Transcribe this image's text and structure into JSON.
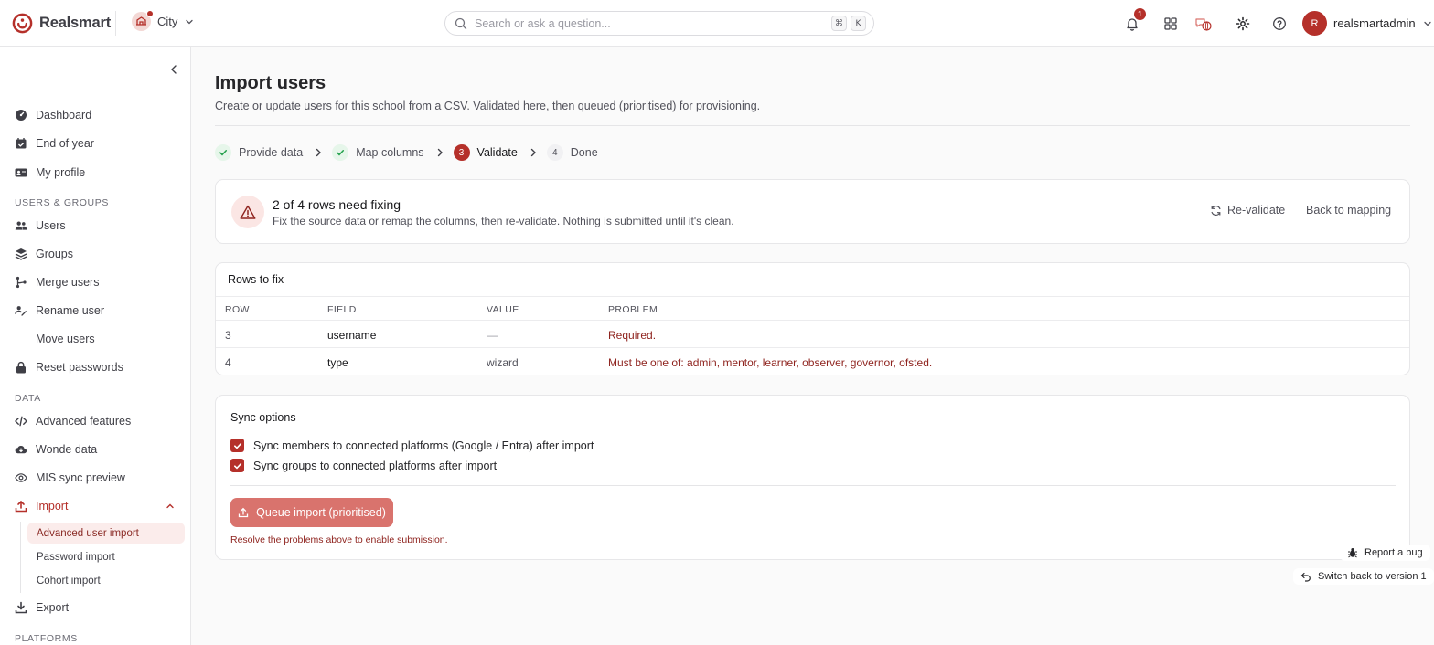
{
  "header": {
    "brand": "Realsmart",
    "org": "City",
    "search_placeholder": "Search or ask a question...",
    "shortcut_keys": [
      "⌘",
      "K"
    ],
    "notification_count": "1",
    "user_initial": "R",
    "user_name": "realsmartadmin"
  },
  "sidebar": {
    "items_top": [
      {
        "label": "Dashboard",
        "icon": "gauge-icon"
      },
      {
        "label": "End of year",
        "icon": "calendar-check-icon"
      },
      {
        "label": "My profile",
        "icon": "id-card-icon"
      }
    ],
    "section_users": "USERS & GROUPS",
    "items_users": [
      {
        "label": "Users",
        "icon": "users-icon"
      },
      {
        "label": "Groups",
        "icon": "layers-icon"
      },
      {
        "label": "Merge users",
        "icon": "merge-icon"
      },
      {
        "label": "Rename user",
        "icon": "signature-icon"
      },
      {
        "label": "Move users",
        "icon": ""
      },
      {
        "label": "Reset passwords",
        "icon": "lock-icon"
      }
    ],
    "section_data": "DATA",
    "items_data": [
      {
        "label": "Advanced features",
        "icon": "code-icon"
      },
      {
        "label": "Wonde data",
        "icon": "cloud-download-icon"
      },
      {
        "label": "MIS sync preview",
        "icon": "eye-icon"
      },
      {
        "label": "Import",
        "icon": "upload-icon"
      }
    ],
    "import_subitems": [
      {
        "label": "Advanced user import",
        "active": true
      },
      {
        "label": "Password import",
        "active": false
      },
      {
        "label": "Cohort import",
        "active": false
      }
    ],
    "export_label": "Export",
    "section_platforms": "PLATFORMS"
  },
  "page": {
    "title": "Import users",
    "description": "Create or update users for this school from a CSV. Validated here, then queued (prioritised) for provisioning."
  },
  "steps": [
    {
      "label": "Provide data",
      "state": "done",
      "num": "1"
    },
    {
      "label": "Map columns",
      "state": "done",
      "num": "2"
    },
    {
      "label": "Validate",
      "state": "current",
      "num": "3"
    },
    {
      "label": "Done",
      "state": "todo",
      "num": "4"
    }
  ],
  "alert": {
    "title": "2 of 4 rows need fixing",
    "description": "Fix the source data or remap the columns, then re-validate. Nothing is submitted until it's clean.",
    "revalidate_label": "Re-validate",
    "back_label": "Back to mapping"
  },
  "rows_to_fix": {
    "title": "Rows to fix",
    "columns": [
      "ROW",
      "FIELD",
      "VALUE",
      "PROBLEM"
    ],
    "rows": [
      {
        "row": "3",
        "field": "username",
        "value": "—",
        "problem": "Required."
      },
      {
        "row": "4",
        "field": "type",
        "value": "wizard",
        "problem": "Must be one of: admin, mentor, learner, observer, governor, ofsted."
      }
    ]
  },
  "sync": {
    "title": "Sync options",
    "options": [
      {
        "label": "Sync members to connected platforms (Google / Entra) after import",
        "checked": true
      },
      {
        "label": "Sync groups to connected platforms after import",
        "checked": true
      }
    ],
    "queue_label": "Queue import (prioritised)",
    "hint": "Resolve the problems above to enable submission."
  },
  "floating": {
    "report_bug": "Report a bug",
    "switch_version": "Switch back to version 1"
  },
  "colors": {
    "accent": "#b5302a",
    "accent_muted": "#d9736d",
    "success": "#22a04b",
    "danger_text": "#8f241f"
  }
}
